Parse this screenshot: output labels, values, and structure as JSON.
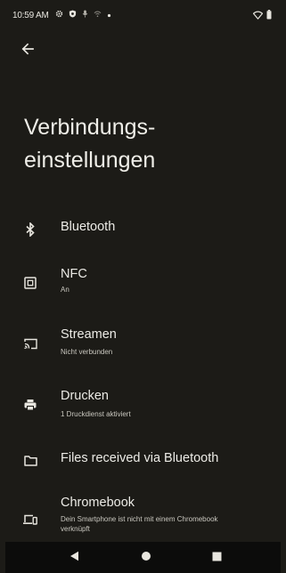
{
  "status_bar": {
    "time": "10:59 AM",
    "icons": [
      "gear-icon",
      "shield-icon",
      "mic-icon",
      "wifi-off-icon",
      "dot-icon"
    ],
    "right_icons": [
      "wifi-icon",
      "battery-icon"
    ]
  },
  "header": {
    "back_icon": "arrow-left-icon",
    "title": "Verbindungs-einstellungen"
  },
  "items": [
    {
      "icon": "bluetooth-icon",
      "title": "Bluetooth",
      "summary": ""
    },
    {
      "icon": "nfc-icon",
      "title": "NFC",
      "summary": "An"
    },
    {
      "icon": "cast-icon",
      "title": "Streamen",
      "summary": "Nicht verbunden"
    },
    {
      "icon": "printer-icon",
      "title": "Drucken",
      "summary": "1 Druckdienst aktiviert"
    },
    {
      "icon": "folder-icon",
      "title": "Files received via Bluetooth",
      "summary": ""
    },
    {
      "icon": "chromebook-icon",
      "title": "Chromebook",
      "summary": "Dein Smartphone ist nicht mit einem Chromebook verknüpft"
    }
  ],
  "navigation": {
    "back_icon": "nav-back-icon",
    "home_icon": "nav-home-icon",
    "recents_icon": "nav-recents-icon"
  },
  "colors": {
    "background": "#1c1b17",
    "navbar": "#0c0c0b",
    "text": "#ecebe6",
    "secondary_text": "#c9c7bf"
  }
}
